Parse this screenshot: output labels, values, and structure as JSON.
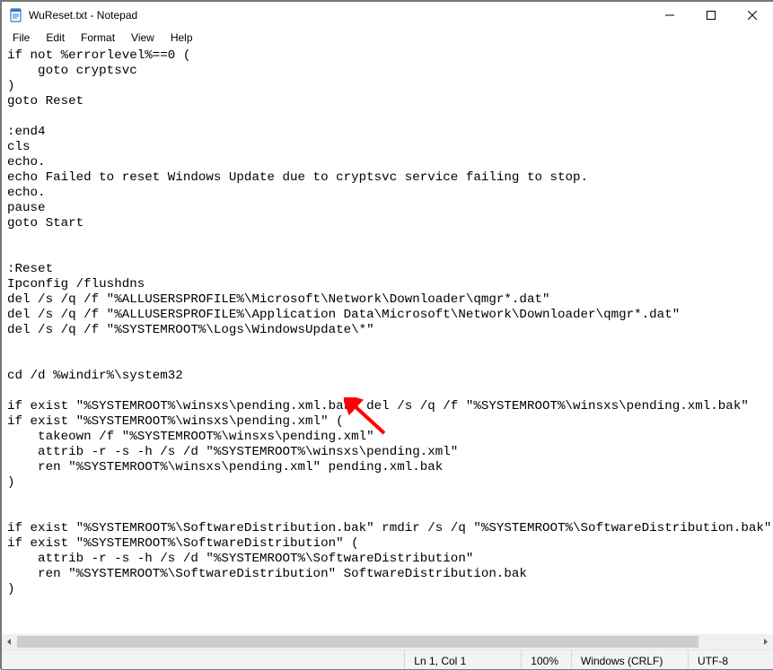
{
  "titlebar": {
    "title": "WuReset.txt - Notepad"
  },
  "menu": {
    "file": "File",
    "edit": "Edit",
    "format": "Format",
    "view": "View",
    "help": "Help"
  },
  "document": {
    "text": "if not %errorlevel%==0 (\n    goto cryptsvc\n)\ngoto Reset\n\n:end4\ncls\necho.\necho Failed to reset Windows Update due to cryptsvc service failing to stop.\necho.\npause\ngoto Start\n\n\n:Reset\nIpconfig /flushdns\ndel /s /q /f \"%ALLUSERSPROFILE%\\Microsoft\\Network\\Downloader\\qmgr*.dat\"\ndel /s /q /f \"%ALLUSERSPROFILE%\\Application Data\\Microsoft\\Network\\Downloader\\qmgr*.dat\"\ndel /s /q /f \"%SYSTEMROOT%\\Logs\\WindowsUpdate\\*\"\n\n\ncd /d %windir%\\system32\n\nif exist \"%SYSTEMROOT%\\winsxs\\pending.xml.bak\" del /s /q /f \"%SYSTEMROOT%\\winsxs\\pending.xml.bak\"\nif exist \"%SYSTEMROOT%\\winsxs\\pending.xml\" (\n    takeown /f \"%SYSTEMROOT%\\winsxs\\pending.xml\"\n    attrib -r -s -h /s /d \"%SYSTEMROOT%\\winsxs\\pending.xml\"\n    ren \"%SYSTEMROOT%\\winsxs\\pending.xml\" pending.xml.bak\n)\n\n\nif exist \"%SYSTEMROOT%\\SoftwareDistribution.bak\" rmdir /s /q \"%SYSTEMROOT%\\SoftwareDistribution.bak\"\nif exist \"%SYSTEMROOT%\\SoftwareDistribution\" (\n    attrib -r -s -h /s /d \"%SYSTEMROOT%\\SoftwareDistribution\"\n    ren \"%SYSTEMROOT%\\SoftwareDistribution\" SoftwareDistribution.bak\n)\n\n"
  },
  "statusbar": {
    "caret": "Ln 1, Col 1",
    "zoom": "100%",
    "eol": "Windows (CRLF)",
    "encoding": "UTF-8"
  },
  "annotation": {
    "arrow_color": "#ff0000"
  }
}
